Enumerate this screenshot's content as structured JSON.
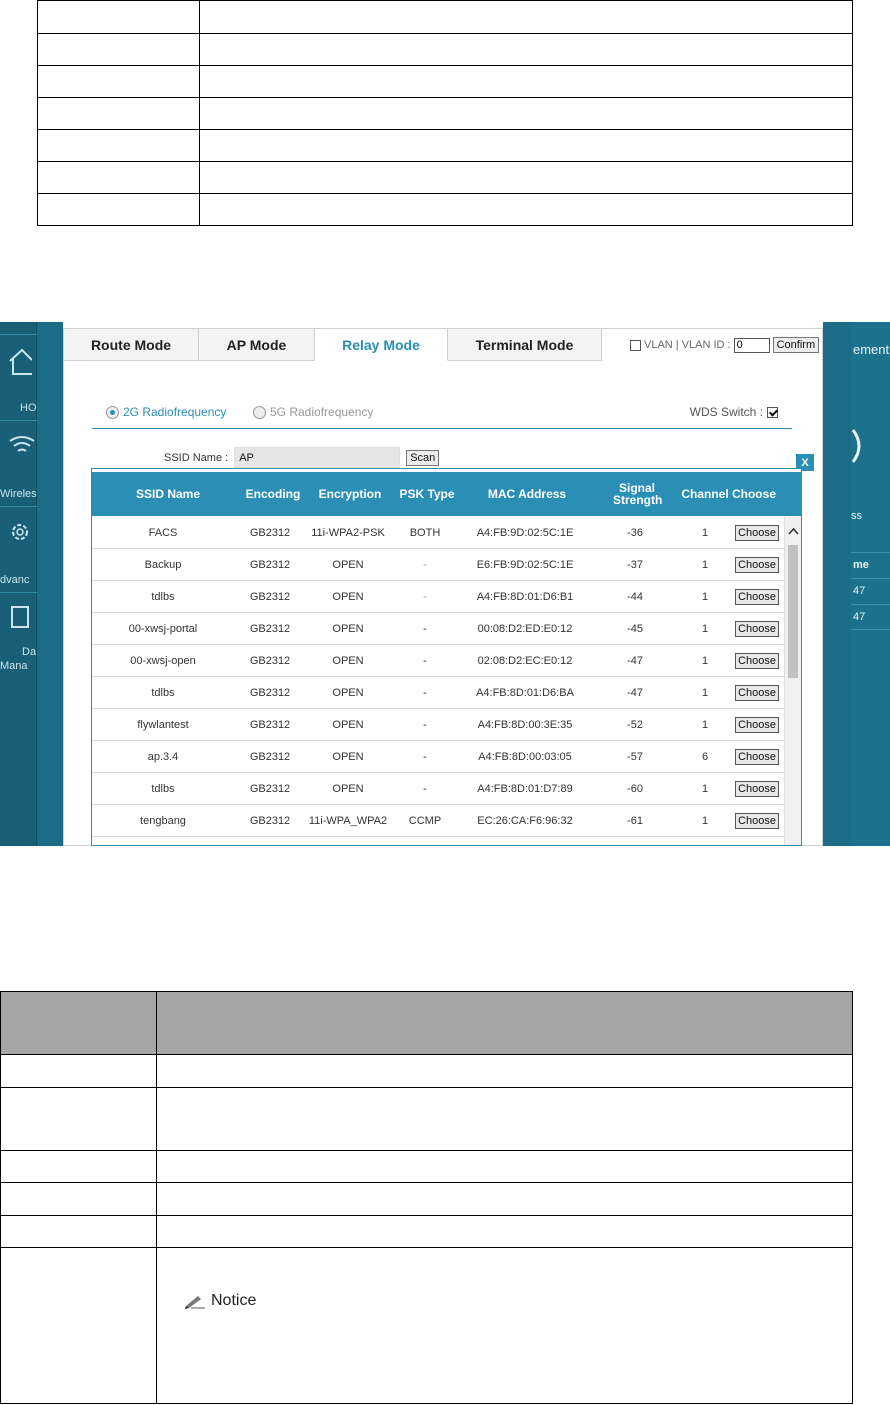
{
  "bottom_notice": "Notice",
  "ui": {
    "tabs": [
      "Route Mode",
      "AP Mode",
      "Relay Mode",
      "Terminal Mode"
    ],
    "active_tab": "Relay Mode",
    "vlan": {
      "label": "VLAN | VLAN ID :",
      "checked": false,
      "value": "0",
      "confirm_label": "Confirm"
    },
    "radio_2g": "2G Radiofrequency",
    "radio_5g": "5G Radiofrequency",
    "selected_radio": "2G Radiofrequency",
    "wds_label": "WDS Switch :",
    "wds_checked": true,
    "ssid_label": "SSID Name :",
    "ssid_value": "AP",
    "scan_label": "Scan",
    "close_label": "X",
    "accent_color": "#2b8fb5",
    "sidebar_fragments": [
      "HO",
      "Wireles",
      "dvanc",
      "Da",
      "Mana"
    ],
    "right_fragments": {
      "top": "ement",
      "middle": "ss",
      "header": "me",
      "rows": [
        "47",
        "47"
      ]
    }
  },
  "scan_table": {
    "headers": [
      "SSID Name",
      "Encoding",
      "Encryption",
      "PSK Type",
      "MAC Address",
      "Signal Strength",
      "Channel",
      "Choose"
    ],
    "choose_label": "Choose",
    "rows": [
      {
        "ssid": "FACS",
        "encoding": "GB2312",
        "encryption": "11i-WPA2-PSK",
        "psk": "BOTH",
        "mac": "A4:FB:9D:02:5C:1E",
        "signal": "-36",
        "channel": "1"
      },
      {
        "ssid": "Backup",
        "encoding": "GB2312",
        "encryption": "OPEN",
        "psk": "-",
        "mac": "E6:FB:9D:02:5C:1E",
        "signal": "-37",
        "channel": "1"
      },
      {
        "ssid": "tdlbs",
        "encoding": "GB2312",
        "encryption": "OPEN",
        "psk": "-",
        "mac": "A4:FB:8D:01:D6:B1",
        "signal": "-44",
        "channel": "1"
      },
      {
        "ssid": "00-xwsj-portal",
        "encoding": "GB2312",
        "encryption": "OPEN",
        "psk": "-",
        "mac": "00:08:D2:ED:E0:12",
        "signal": "-45",
        "channel": "1"
      },
      {
        "ssid": "00-xwsj-open",
        "encoding": "GB2312",
        "encryption": "OPEN",
        "psk": "-",
        "mac": "02:08:D2:EC:E0:12",
        "signal": "-47",
        "channel": "1"
      },
      {
        "ssid": "tdlbs",
        "encoding": "GB2312",
        "encryption": "OPEN",
        "psk": "-",
        "mac": "A4:FB:8D:01:D6:BA",
        "signal": "-47",
        "channel": "1"
      },
      {
        "ssid": "flywlantest",
        "encoding": "GB2312",
        "encryption": "OPEN",
        "psk": "-",
        "mac": "A4:FB:8D:00:3E:35",
        "signal": "-52",
        "channel": "1"
      },
      {
        "ssid": "ap.3.4",
        "encoding": "GB2312",
        "encryption": "OPEN",
        "psk": "-",
        "mac": "A4:FB:8D:00:03:05",
        "signal": "-57",
        "channel": "6"
      },
      {
        "ssid": "tdlbs",
        "encoding": "GB2312",
        "encryption": "OPEN",
        "psk": "-",
        "mac": "A4:FB:8D:01:D7:89",
        "signal": "-60",
        "channel": "1"
      },
      {
        "ssid": "tengbang",
        "encoding": "GB2312",
        "encryption": "11i-WPA_WPA2",
        "psk": "CCMP",
        "mac": "EC:26:CA:F6:96:32",
        "signal": "-61",
        "channel": "1"
      }
    ]
  }
}
